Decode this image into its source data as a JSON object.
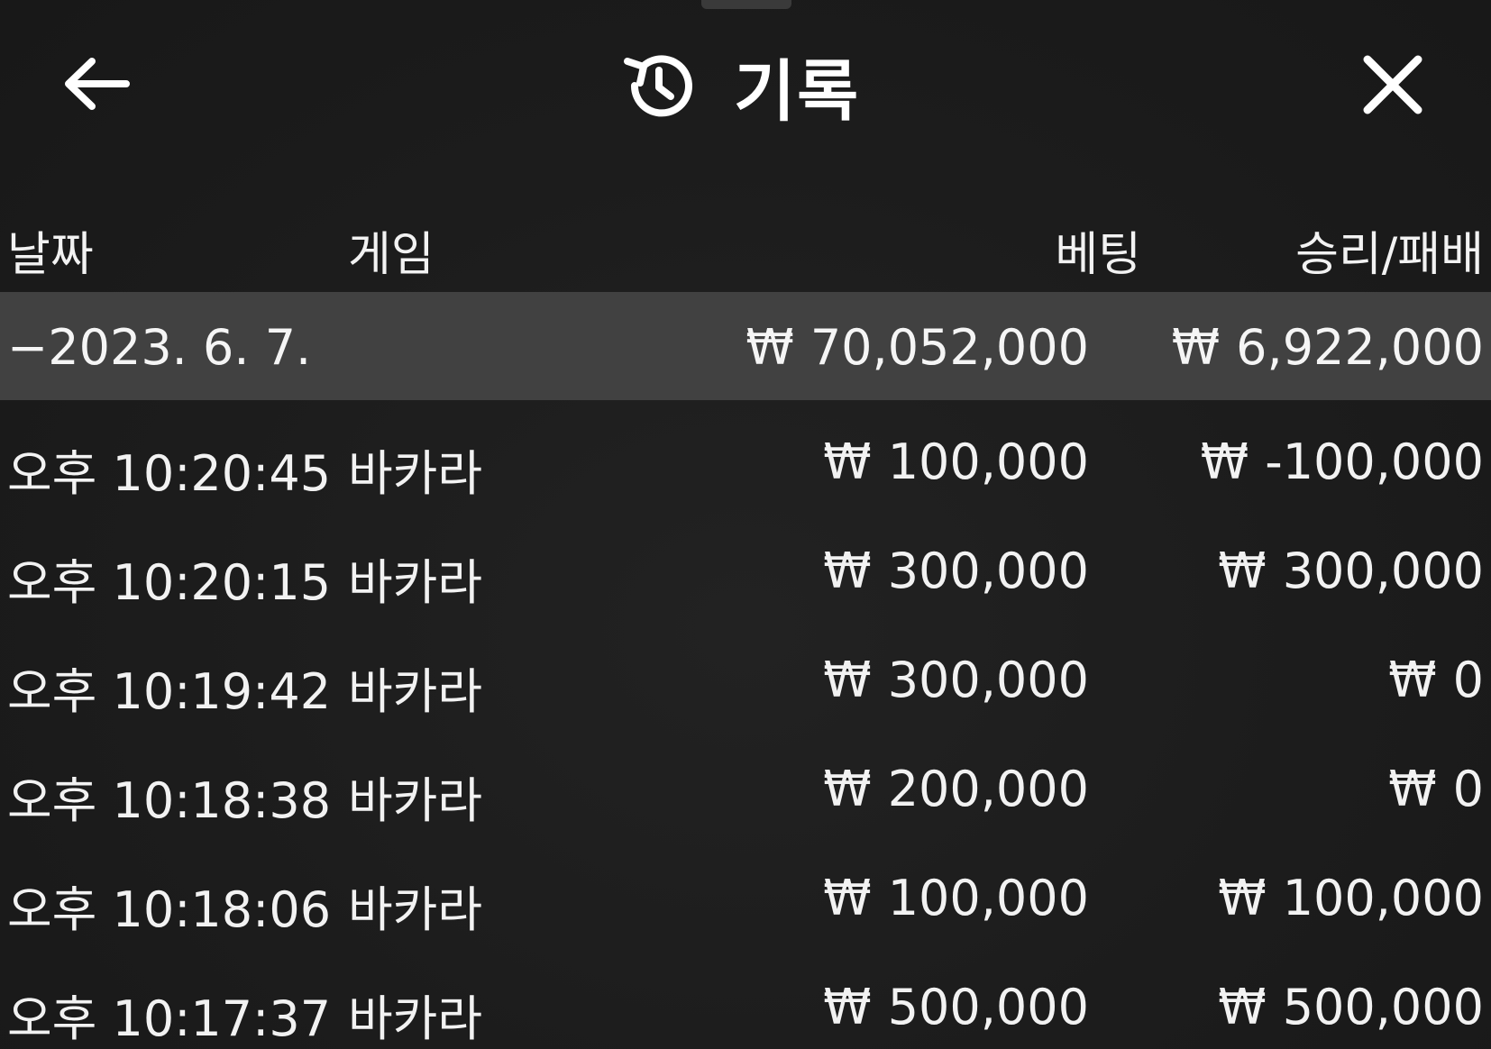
{
  "header": {
    "title": "기록",
    "back_icon": "arrow-left-icon",
    "history_icon": "history-clock-icon",
    "close_icon": "close-icon"
  },
  "columns": {
    "date": "날짜",
    "game": "게임",
    "bet": "베팅",
    "result": "승리/패배"
  },
  "currency_symbol": "₩",
  "date_group": {
    "label": "−2023. 6. 7.",
    "bet_total": "70,052,000",
    "result_total": "6,922,000"
  },
  "rows": [
    {
      "time": "오후 10:20:45",
      "game": "바카라",
      "bet": "100,000",
      "result": "-100,000"
    },
    {
      "time": "오후 10:20:15",
      "game": "바카라",
      "bet": "300,000",
      "result": "300,000"
    },
    {
      "time": "오후 10:19:42",
      "game": "바카라",
      "bet": "300,000",
      "result": "0"
    },
    {
      "time": "오후 10:18:38",
      "game": "바카라",
      "bet": "200,000",
      "result": "0"
    },
    {
      "time": "오후 10:18:06",
      "game": "바카라",
      "bet": "100,000",
      "result": "100,000"
    },
    {
      "time": "오후 10:17:37",
      "game": "바카라",
      "bet": "500,000",
      "result": "500,000"
    }
  ],
  "colors": {
    "background": "#1b1b1b",
    "date_row": "#414141",
    "text": "#f2f2f2"
  }
}
